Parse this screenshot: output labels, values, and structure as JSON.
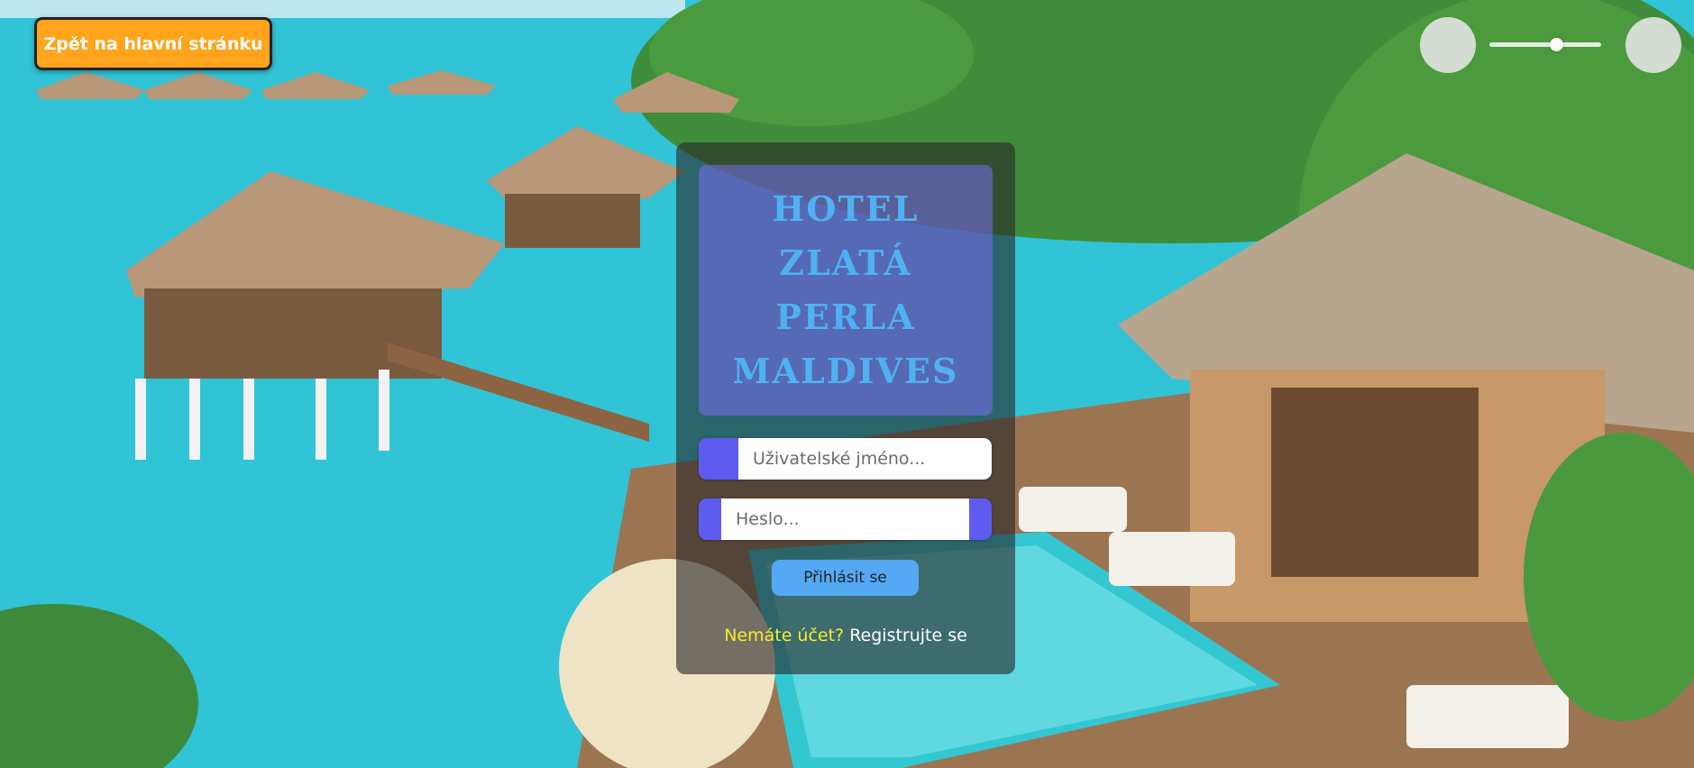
{
  "nav": {
    "back_label": "Zpět na hlavní stránku"
  },
  "zoom": {
    "minus_glyph": "",
    "plus_glyph": "",
    "level": 0.6
  },
  "hotel": {
    "title_lines": [
      "HOTEL",
      "ZLATÁ",
      "PERLA",
      "MALDIVES"
    ]
  },
  "login": {
    "username_placeholder": "Uživatelské jméno...",
    "password_placeholder": "Heslo...",
    "user_icon_glyph": "",
    "lock_icon_glyph": "",
    "eye_icon_glyph": "",
    "submit_label": "Přihlásit se"
  },
  "register": {
    "question": "Nemáte účet?",
    "link_label": "Registrujte se"
  },
  "colors": {
    "accent_orange": "#ffa41c",
    "icon_purple": "#5e5cf0",
    "title_blue": "#4fb1f2",
    "button_blue": "#54a8f4",
    "question_yellow": "#f4ee2e"
  }
}
